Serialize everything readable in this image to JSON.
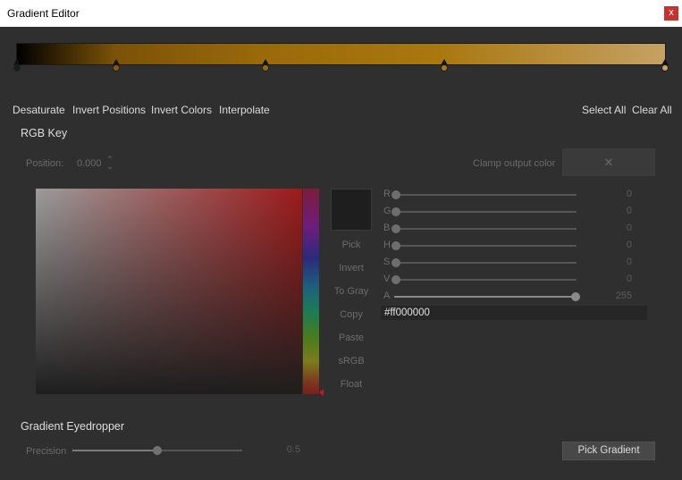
{
  "window": {
    "title": "Gradient Editor",
    "close_glyph": "x"
  },
  "gradient": {
    "stops": [
      {
        "position": 0.0,
        "color": "#1a1a1a"
      },
      {
        "position": 0.155,
        "color": "#8a5a0c"
      },
      {
        "position": 0.384,
        "color": "#9a6a10"
      },
      {
        "position": 0.659,
        "color": "#a97a1c"
      },
      {
        "position": 1.0,
        "color": "#c9a36a"
      }
    ]
  },
  "toolbar": {
    "desaturate": "Desaturate",
    "invert_positions": "Invert Positions",
    "invert_colors": "Invert Colors",
    "interpolate": "Interpolate",
    "select_all": "Select All",
    "clear_all": "Clear All"
  },
  "rgb_key": {
    "heading": "RGB Key",
    "position_label": "Position:",
    "position_value": "0.000",
    "spin_glyph": "⌃⌄",
    "clamp_label": "Clamp output color",
    "clamp_glyph": "✕"
  },
  "picker": {
    "buttons": [
      "Pick",
      "Invert",
      "To Gray",
      "Copy",
      "Paste",
      "sRGB",
      "Float"
    ],
    "hex_value": "#ff000000",
    "current_color": "#1e1e1e"
  },
  "channels": [
    {
      "label": "R",
      "value": "0",
      "level": 0.0
    },
    {
      "label": "G",
      "value": "0",
      "level": 0.0
    },
    {
      "label": "B",
      "value": "0",
      "level": 0.0
    },
    {
      "label": "H",
      "value": "0",
      "level": 0.0
    },
    {
      "label": "S",
      "value": "0",
      "level": 0.0
    },
    {
      "label": "V",
      "value": "0",
      "level": 0.0
    },
    {
      "label": "A",
      "value": "255",
      "level": 1.0
    }
  ],
  "eyedropper": {
    "heading": "Gradient Eyedropper",
    "precision_label": "Precision",
    "precision_value": "0.5",
    "precision_level": 0.5,
    "pick_button": "Pick Gradient"
  }
}
